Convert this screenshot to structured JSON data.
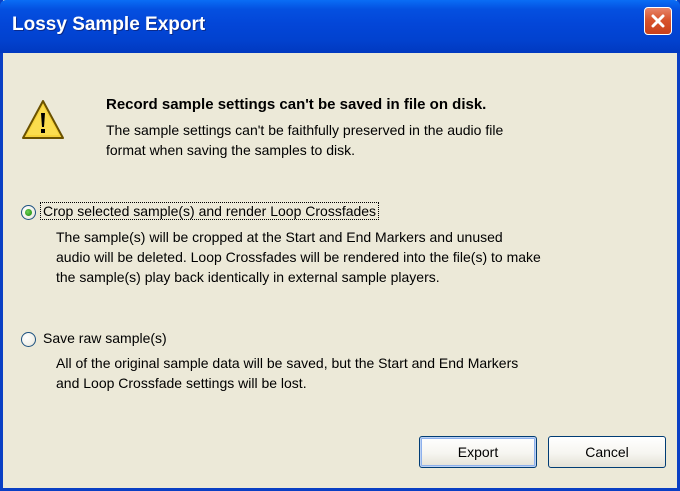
{
  "window": {
    "title": "Lossy Sample Export",
    "close_icon": "close-icon"
  },
  "message": {
    "icon": "warning-icon",
    "headline": "Record sample settings can't be saved in file on disk.",
    "body_line_1": "The sample settings can't be faithfully preserved in the audio file",
    "body_line_2": "format when saving the samples to disk."
  },
  "options": [
    {
      "label": "Crop selected sample(s) and render Loop Crossfades",
      "selected": true,
      "desc_1": "The sample(s) will be cropped at the Start and End Markers and unused",
      "desc_2": "audio will be deleted. Loop Crossfades will be rendered into the file(s) to make",
      "desc_3": "the sample(s) play back identically in external sample players."
    },
    {
      "label": "Save raw sample(s)",
      "selected": false,
      "desc_1": "All of the original sample data will be saved, but the Start and End Markers",
      "desc_2": "and Loop Crossfade settings will be lost."
    }
  ],
  "buttons": {
    "export": "Export",
    "cancel": "Cancel"
  },
  "colors": {
    "titlebar": "#0346d8",
    "dialog_bg": "#ece9d8",
    "close_button": "#d8542d"
  }
}
